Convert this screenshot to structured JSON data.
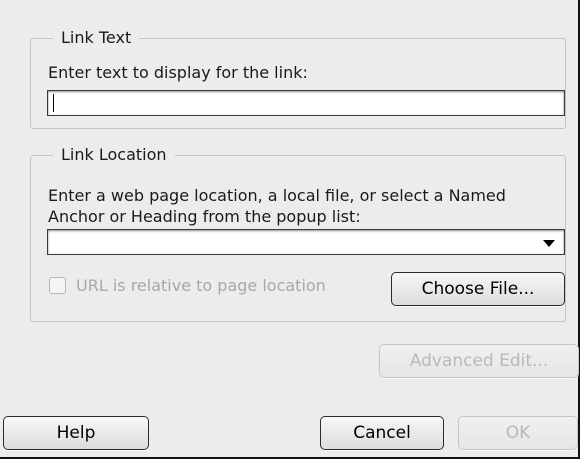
{
  "link_text": {
    "legend": "Link Text",
    "prompt": "Enter text to display for the link:",
    "value": ""
  },
  "link_location": {
    "legend": "Link Location",
    "prompt_line1": "Enter a web page location, a local file, or select a Named",
    "prompt_line2": "Anchor or Heading from the popup list:",
    "url_value": "",
    "relative_checkbox_label": "URL is relative to page location",
    "relative_checked": false,
    "choose_file_label": "Choose File..."
  },
  "advanced_edit_label": "Advanced Edit...",
  "footer": {
    "help_label": "Help",
    "cancel_label": "Cancel",
    "ok_label": "OK"
  },
  "colors": {
    "dialog_bg": "#ececec",
    "disabled_text": "#b9b9b9",
    "border_dark": "#111111"
  }
}
